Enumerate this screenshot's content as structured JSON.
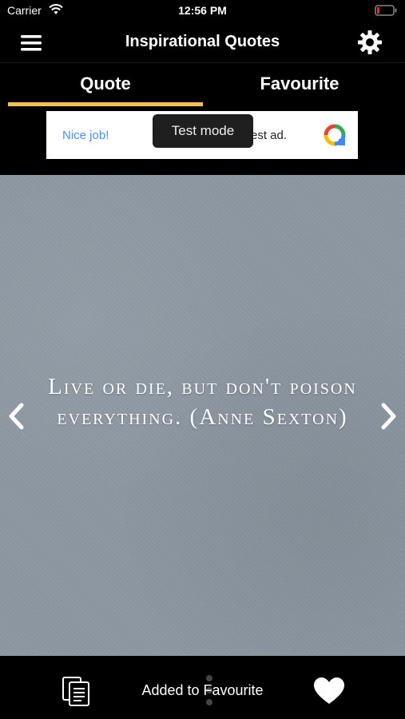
{
  "status_bar": {
    "carrier": "Carrier",
    "time": "12:56 PM",
    "battery_color": "#e5342e"
  },
  "nav": {
    "title": "Inspirational Quotes",
    "menu_icon": "hamburger-menu-icon",
    "settings_icon": "gear-icon"
  },
  "tabs": [
    {
      "label": "Quote",
      "selected": true
    },
    {
      "label": "Favourite",
      "selected": false
    }
  ],
  "tab_indicator_color": "#f2c14e",
  "ad": {
    "left_text": "Nice job!",
    "right_text": "est ad.",
    "toast": "Test mode"
  },
  "quote": {
    "text": "Live or die, but don't poison everything. (Anne Sexton)"
  },
  "bottom": {
    "toast": "Added to Favourite",
    "copy_icon": "copy-icon",
    "share_icon": "share-icon",
    "favourite_icon": "heart-icon"
  }
}
